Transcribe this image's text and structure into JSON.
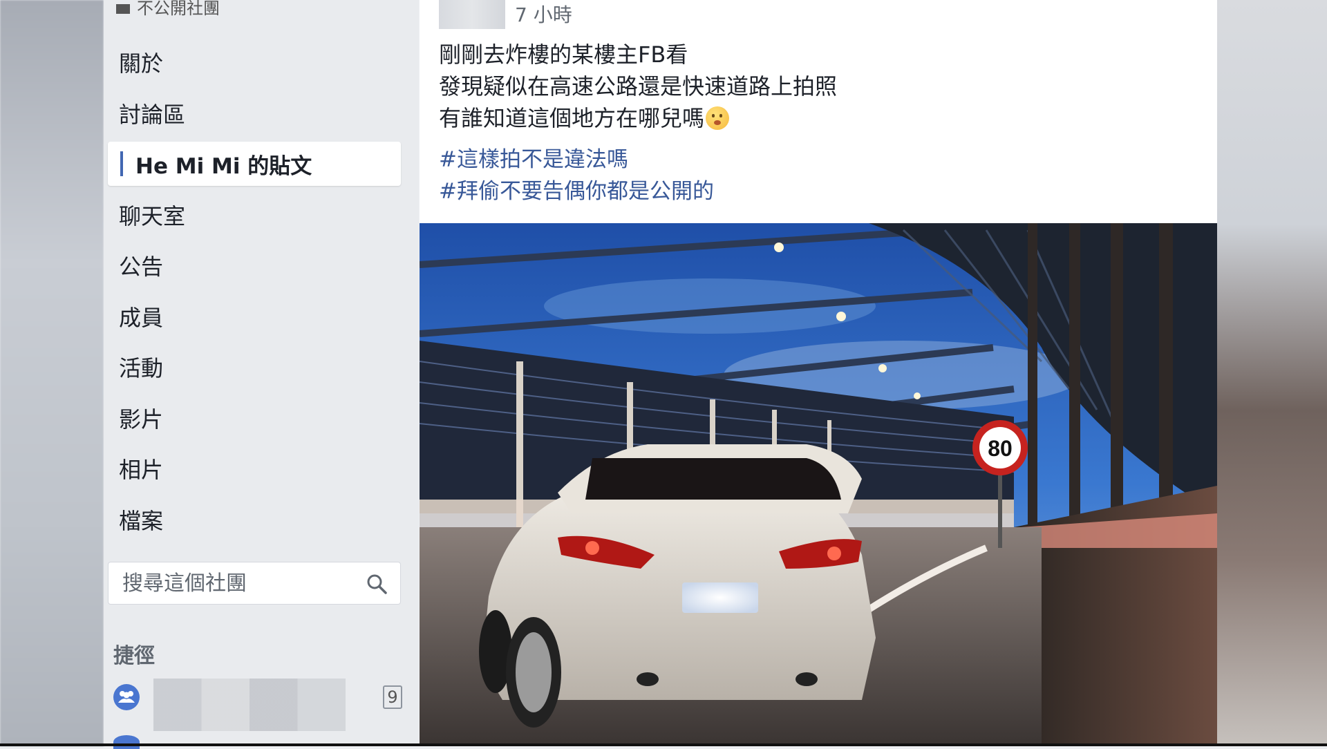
{
  "sidebar": {
    "group_type": "不公開社團",
    "nav": [
      {
        "label": "關於"
      },
      {
        "label": "討論區"
      },
      {
        "label": "He Mi Mi 的貼文",
        "active": true
      },
      {
        "label": "聊天室"
      },
      {
        "label": "公告"
      },
      {
        "label": "成員"
      },
      {
        "label": "活動"
      },
      {
        "label": "影片"
      },
      {
        "label": "相片"
      },
      {
        "label": "檔案"
      }
    ],
    "search": {
      "placeholder": "搜尋這個社團",
      "icon": "search-icon"
    },
    "shortcuts_title": "捷徑",
    "shortcut": {
      "count": "9",
      "icon": "group-icon"
    }
  },
  "post": {
    "timestamp": "7 小時",
    "lines": [
      "剛剛去炸樓的某樓主FB看",
      "發現疑似在高速公路還是快速道路上拍照",
      "有誰知道這個地方在哪兒嗎"
    ],
    "emoji": "flushed-face-emoji",
    "hashtags": [
      "#這樣拍不是違法嗎",
      "#拜偷不要告偶你都是公開的"
    ],
    "photo": {
      "speed_sign": "80"
    }
  },
  "colors": {
    "link": "#385898",
    "accent": "#4267b2",
    "sidebar_bg": "#e9ebee"
  }
}
